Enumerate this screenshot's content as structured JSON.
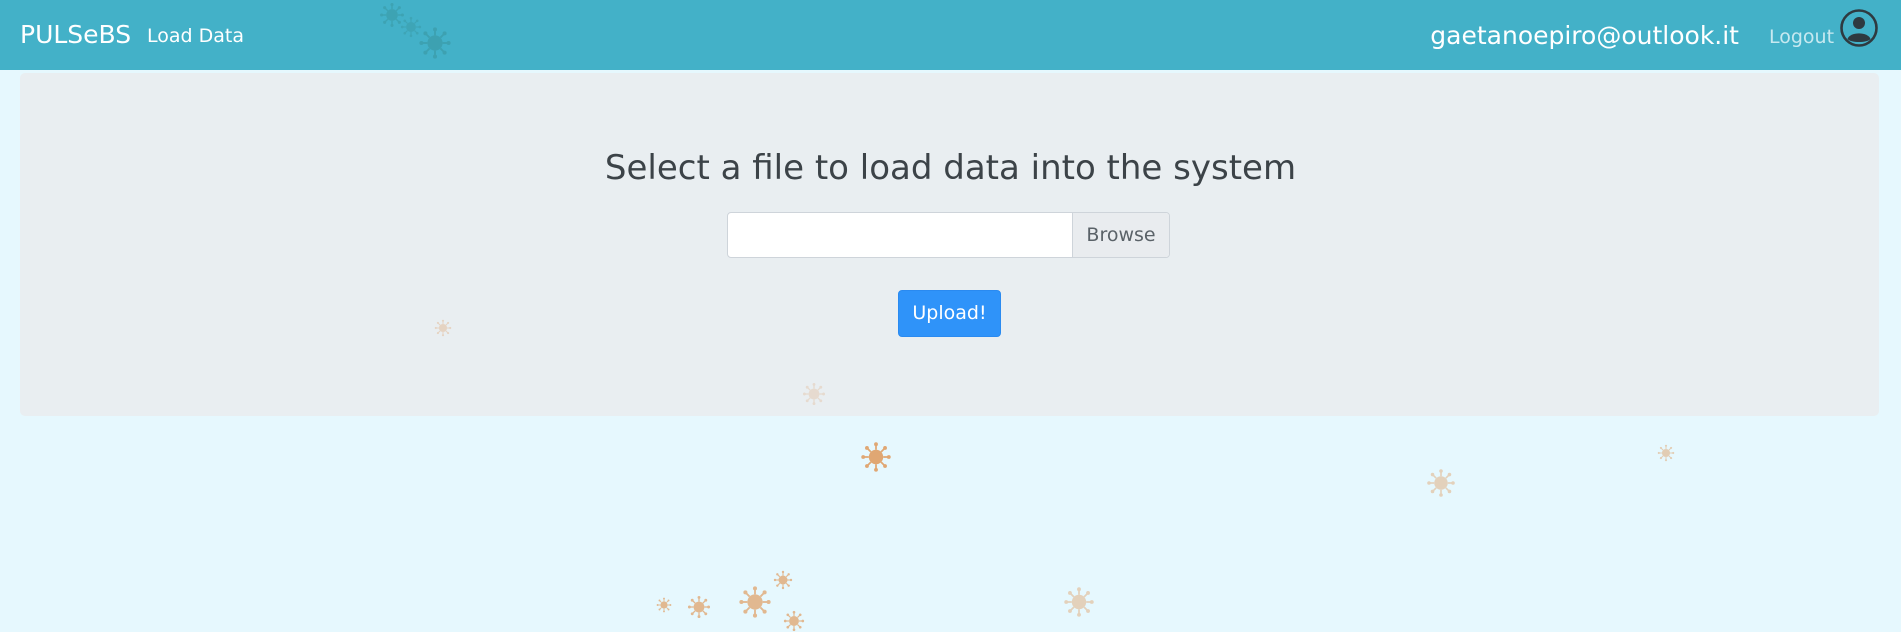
{
  "navbar": {
    "brand": "PULSeBS",
    "links": [
      {
        "label": "Load Data"
      }
    ],
    "user_email": "gaetanoepiro@outlook.it",
    "logout_label": "Logout",
    "avatar_icon": "user-circle-icon",
    "background_color": "#43b1c8"
  },
  "main": {
    "title": "Select a file to load data into the system",
    "file_input": {
      "value": "",
      "browse_label": "Browse"
    },
    "upload_button_label": "Upload!",
    "accent_color": "#2f93f9"
  },
  "background": {
    "decoration_icon": "virus-icon",
    "colors": [
      "#e0a36c",
      "#3a9aa6"
    ]
  }
}
